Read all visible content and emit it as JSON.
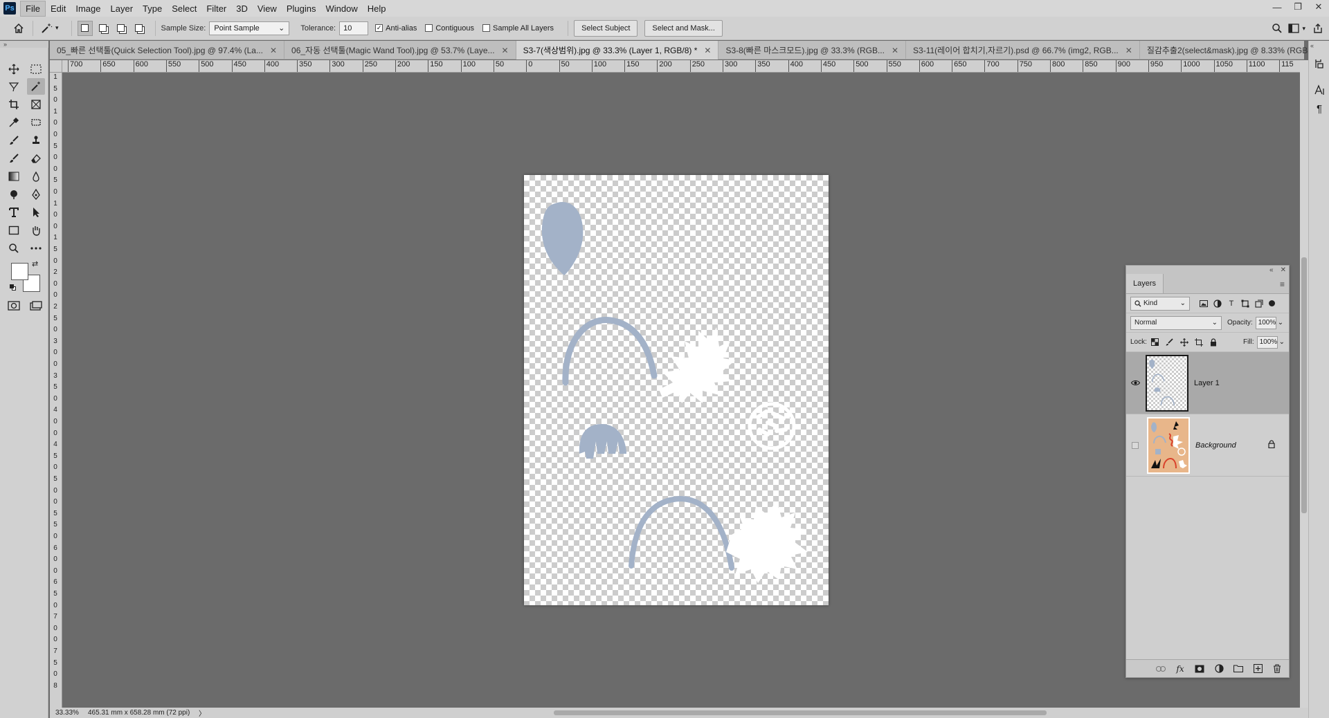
{
  "menu": {
    "logo": "Ps",
    "items": [
      "File",
      "Edit",
      "Image",
      "Layer",
      "Type",
      "Select",
      "Filter",
      "3D",
      "View",
      "Plugins",
      "Window",
      "Help"
    ],
    "active": "File"
  },
  "window_controls": {
    "minimize": "—",
    "restore": "❐",
    "close": "✕"
  },
  "options": {
    "sample_size_label": "Sample Size:",
    "sample_size_value": "Point Sample",
    "tolerance_label": "Tolerance:",
    "tolerance_value": "10",
    "anti_alias_label": "Anti-alias",
    "anti_alias_checked": true,
    "contiguous_label": "Contiguous",
    "contiguous_checked": false,
    "sample_all_label": "Sample All Layers",
    "sample_all_checked": false,
    "select_subject_label": "Select Subject",
    "select_mask_label": "Select and Mask..."
  },
  "tabs": [
    {
      "label": "05_빠른 선택툴(Quick Selection Tool).jpg @ 97.4% (La...",
      "active": false
    },
    {
      "label": "06_자동 선택툴(Magic Wand Tool).jpg @ 53.7% (Laye...",
      "active": false
    },
    {
      "label": "S3-7(색상범위).jpg @ 33.3% (Layer 1, RGB/8) *",
      "active": true
    },
    {
      "label": "S3-8(빠른 마스크모드).jpg @ 33.3% (RGB...",
      "active": false
    },
    {
      "label": "S3-11(레이어 합치기,자르기).psd @ 66.7% (img2, RGB...",
      "active": false
    },
    {
      "label": "질감추출2(select&mask).jpg @ 8.33% (RGB...",
      "active": false
    }
  ],
  "ruler_h": [
    "700",
    "650",
    "600",
    "550",
    "500",
    "450",
    "400",
    "350",
    "300",
    "250",
    "200",
    "150",
    "100",
    "50",
    "0",
    "50",
    "100",
    "150",
    "200",
    "250",
    "300",
    "350",
    "400",
    "450",
    "500",
    "550",
    "600",
    "650",
    "700",
    "750",
    "800",
    "850",
    "900",
    "950",
    "1000",
    "1050",
    "1100",
    "115"
  ],
  "ruler_v": [
    "1",
    "5",
    "0",
    "1",
    "0",
    "0",
    "5",
    "0",
    "0",
    "5",
    "0",
    "1",
    "0",
    "0",
    "1",
    "5",
    "0",
    "2",
    "0",
    "0",
    "2",
    "5",
    "0",
    "3",
    "0",
    "0",
    "3",
    "5",
    "0",
    "4",
    "0",
    "0",
    "4",
    "5",
    "0",
    "5",
    "0",
    "0",
    "5",
    "5",
    "0",
    "6",
    "0",
    "0",
    "6",
    "5",
    "0",
    "7",
    "0",
    "0",
    "7",
    "5",
    "0",
    "8"
  ],
  "status": {
    "zoom": "33.33%",
    "doc_size": "465.31 mm x 658.28 mm (72 ppi)",
    "arrow": "〉"
  },
  "layers_panel": {
    "title": "Layers",
    "collapse": "«",
    "close": "✕",
    "menu": "≡",
    "filter_kind": "Kind",
    "blend_mode": "Normal",
    "opacity_label": "Opacity:",
    "opacity_value": "100%",
    "lock_label": "Lock:",
    "fill_label": "Fill:",
    "fill_value": "100%",
    "layers": [
      {
        "name": "Layer 1",
        "visible": true,
        "selected": true,
        "italic": false,
        "locked": false
      },
      {
        "name": "Background",
        "visible": false,
        "selected": false,
        "italic": true,
        "locked": true
      }
    ]
  },
  "colors": {
    "shape_blue": "#a3b2c8",
    "shape_white": "#ffffff",
    "bg_thumb": "#e8b68a"
  }
}
